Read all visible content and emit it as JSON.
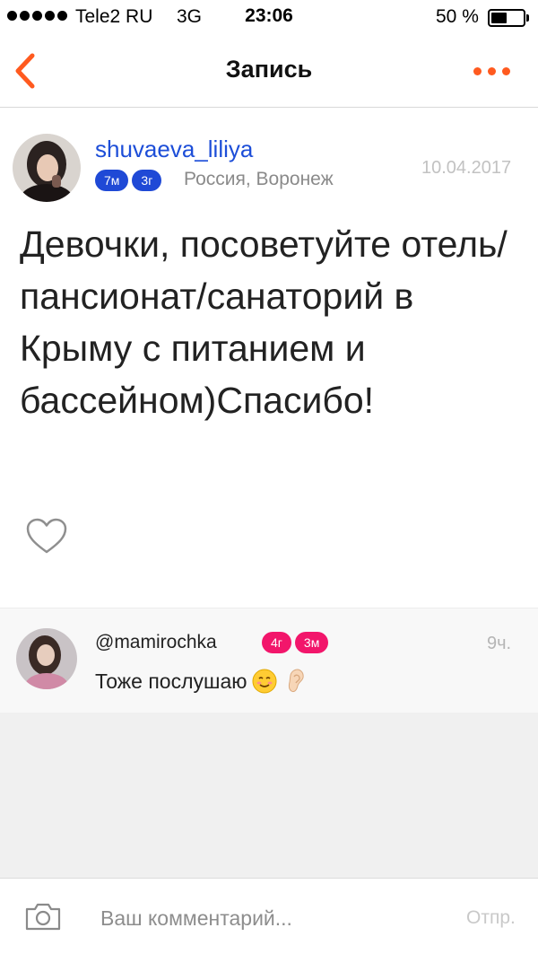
{
  "status_bar": {
    "carrier": "Tele2 RU",
    "network": "3G",
    "time": "23:06",
    "battery_percent": "50 %",
    "battery_level": 0.5
  },
  "nav": {
    "title": "Запись",
    "back_icon": "chevron-left-icon",
    "more_icon": "more-dots-icon",
    "accent_color": "#ff5a1f"
  },
  "post": {
    "author": "shuvaeva_liliya",
    "badges": [
      "7м",
      "3г"
    ],
    "location": "Россия, Воронеж",
    "date": "10.04.2017",
    "text": "Девочки, посоветуйте отель/пансионат/санаторий в Крыму с питанием и бассейном)Спасибо!",
    "like_icon": "heart-outline-icon"
  },
  "comments": [
    {
      "author": "@mamirochka",
      "badges": [
        "4г",
        "3м"
      ],
      "time": "9ч.",
      "text": "Тоже послушаю",
      "emoji": [
        "smiling-face-icon",
        "ear-icon"
      ]
    }
  ],
  "composer": {
    "placeholder": "Ваш комментарий...",
    "send_label": "Отпр.",
    "camera_icon": "camera-icon"
  },
  "colors": {
    "badge_blue": "#1f49d6",
    "badge_pink": "#f2166b",
    "link_blue": "#1d4ed8"
  }
}
